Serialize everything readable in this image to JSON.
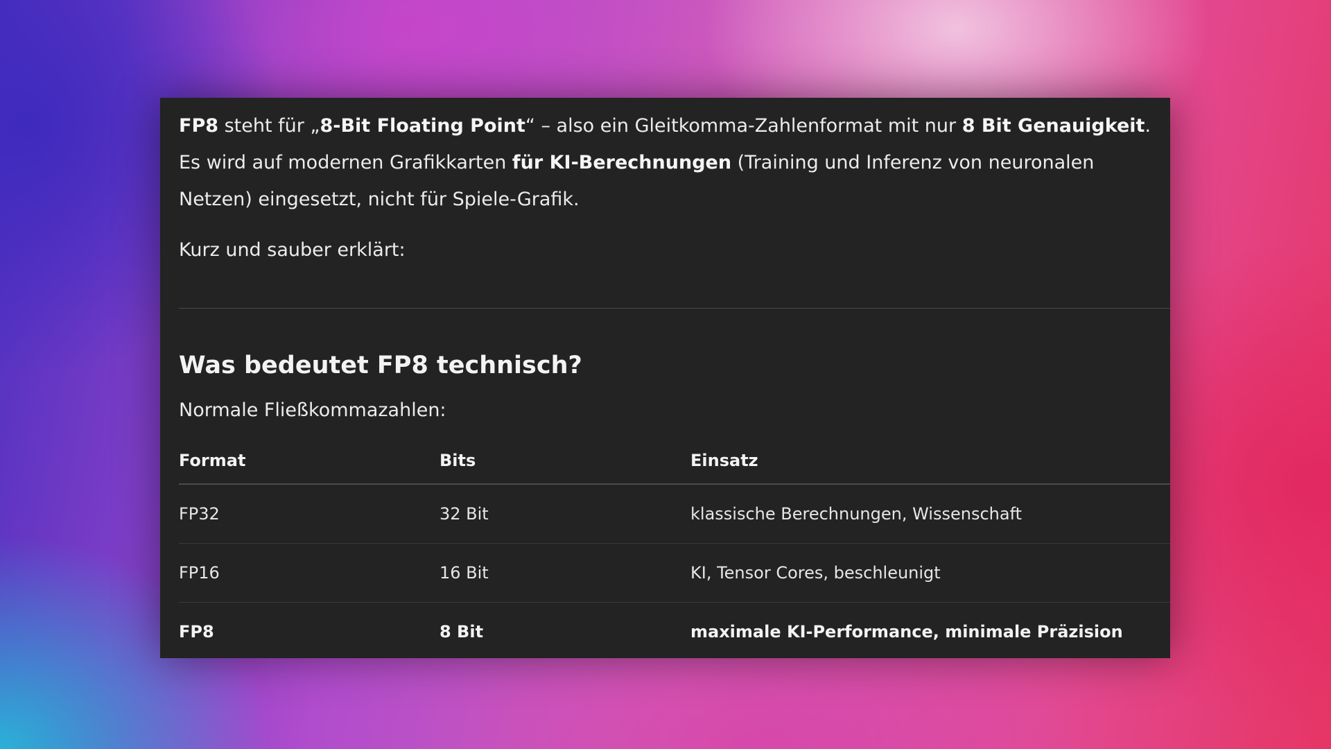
{
  "intro": {
    "line1": {
      "b1": "FP8",
      "t1": " steht für „",
      "b2": "8-Bit Floating Point",
      "t2": "“ – also ein Gleitkomma-Zahlenformat mit nur ",
      "b3": "8 Bit Genauigkeit",
      "t3": "."
    },
    "line2": {
      "t1": "Es wird auf modernen Grafikkarten ",
      "b1": "für KI-Berechnungen",
      "t2": " (Training und Inferenz von neuronalen Netzen) eingesetzt, nicht für Spiele-Grafik."
    },
    "short_text": "Kurz und sauber erklärt:"
  },
  "section": {
    "heading": "Was bedeutet FP8 technisch?",
    "subheading": "Normale Fließkommazahlen:"
  },
  "table": {
    "headers": [
      "Format",
      "Bits",
      "Einsatz"
    ],
    "rows": [
      [
        "FP32",
        "32 Bit",
        "klassische Berechnungen, Wissenschaft"
      ],
      [
        "FP16",
        "16 Bit",
        "KI, Tensor Cores, beschleunigt"
      ],
      [
        "FP8",
        "8 Bit",
        "maximale KI-Performance, minimale Präzision"
      ]
    ]
  },
  "colors": {
    "panel_bg": "#232323",
    "text": "#ececec"
  }
}
